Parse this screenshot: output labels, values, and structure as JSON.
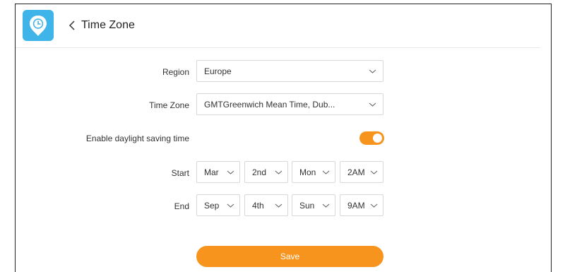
{
  "header": {
    "title": "Time Zone",
    "app_icon": "clock-pin-icon",
    "back_icon": "chevron-left-icon"
  },
  "form": {
    "region": {
      "label": "Region",
      "value": "Europe"
    },
    "timezone": {
      "label": "Time Zone",
      "value": "GMTGreenwich Mean Time, Dub..."
    },
    "dst": {
      "label": "Enable daylight saving time",
      "enabled": true
    },
    "start": {
      "label": "Start",
      "month": "Mar",
      "week": "2nd",
      "day": "Mon",
      "time": "2AM"
    },
    "end": {
      "label": "End",
      "month": "Sep",
      "week": "4th",
      "day": "Sun",
      "time": "9AM"
    }
  },
  "actions": {
    "save_label": "Save"
  },
  "colors": {
    "accent": "#f7941d",
    "app_icon_bg": "#3fb4e8"
  }
}
